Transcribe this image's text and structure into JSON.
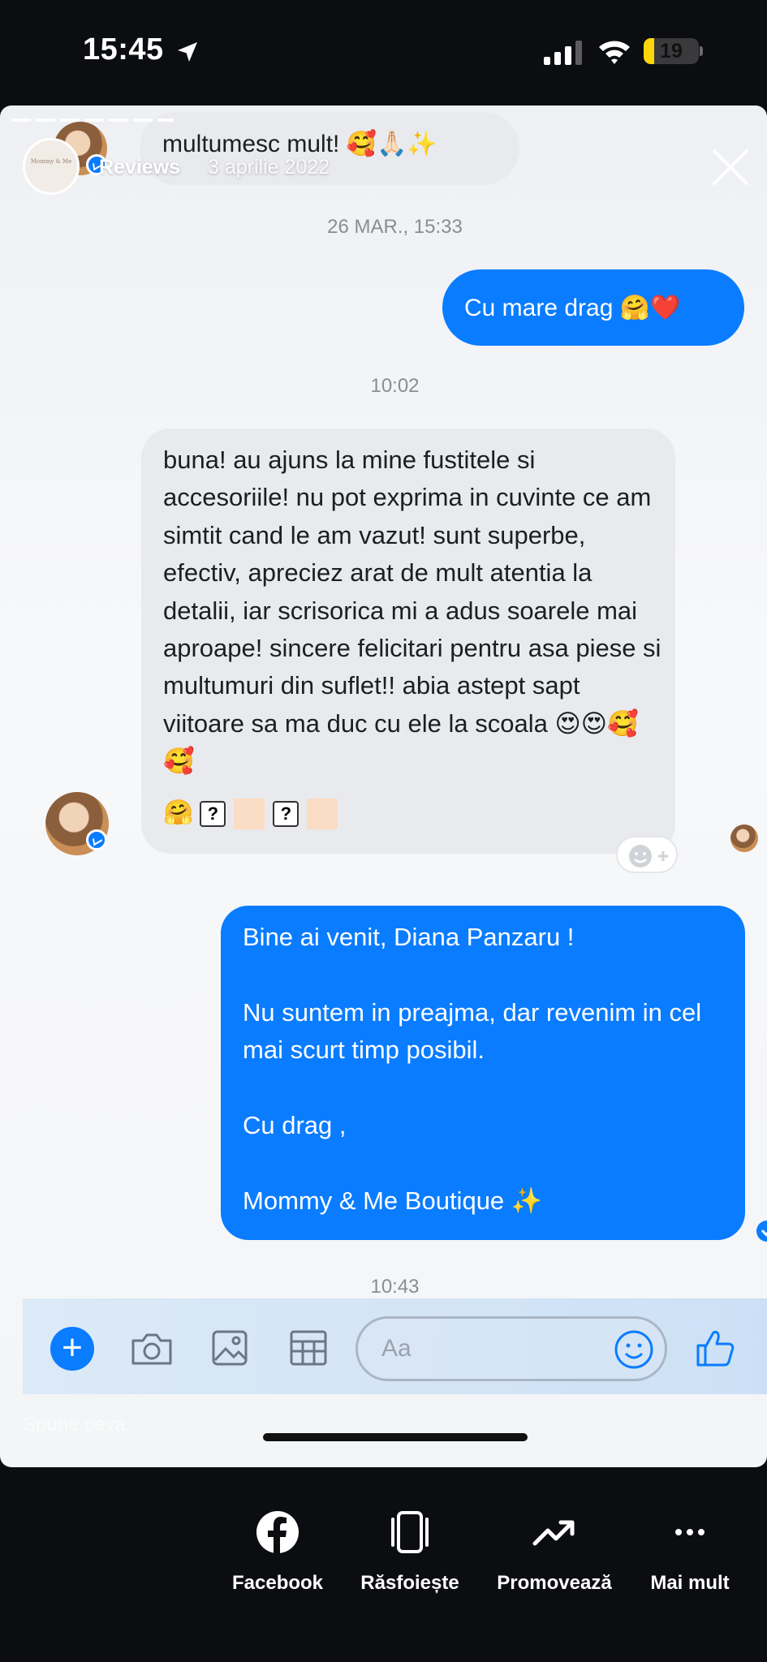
{
  "status_bar": {
    "time": "15:45",
    "battery": "19",
    "battery_level_percent": 19,
    "battery_color": "#ffd60a"
  },
  "story_header": {
    "account_label": "Reviews",
    "date": "3 aprilie 2022",
    "logo_text": "Mommy & Me"
  },
  "chat": {
    "pinned_message": "multumesc mult! 🥰🙏🏻✨",
    "timestamp_1": "26 MAR., 15:33",
    "outgoing_1": "Cu mare drag 🤗❤️",
    "timestamp_2": "10:02",
    "incoming_1": "buna! au ajuns la mine fustitele si accesoriile! nu pot exprima in cuvinte ce am simtit cand le am vazut! sunt superbe, efectiv, apreciez arat de mult atentia la detalii, iar scrisorica mi a adus soarele mai aproape! sincere felicitari pentru asa piese si multumuri din suflet!! abia astept sapt viitoare sa ma duc cu ele la scoala 😍😍🥰🥰",
    "incoming_1_tail_emoji": "🤗",
    "incoming_1_box_glyph": "?",
    "outgoing_2": "Bine ai venit, Diana Panzaru !\n\nNu suntem in preajma, dar revenim in cel mai scurt timp posibil.\n\nCu drag ,\n\nMommy & Me Boutique  ✨",
    "timestamp_3": "10:43"
  },
  "composer": {
    "placeholder": "Aa",
    "send_hint": "Spune ceva..."
  },
  "bottom_actions": [
    {
      "label": "Facebook",
      "icon": "facebook-icon"
    },
    {
      "label": "Răsfoiește",
      "icon": "browse-icon"
    },
    {
      "label": "Promovează",
      "icon": "trending-up-icon"
    },
    {
      "label": "Mai mult",
      "icon": "more-icon"
    }
  ],
  "colors": {
    "messenger_blue": "#0a7cff",
    "incoming_gray": "#e9eaed",
    "background_dark": "#0b0d11"
  }
}
